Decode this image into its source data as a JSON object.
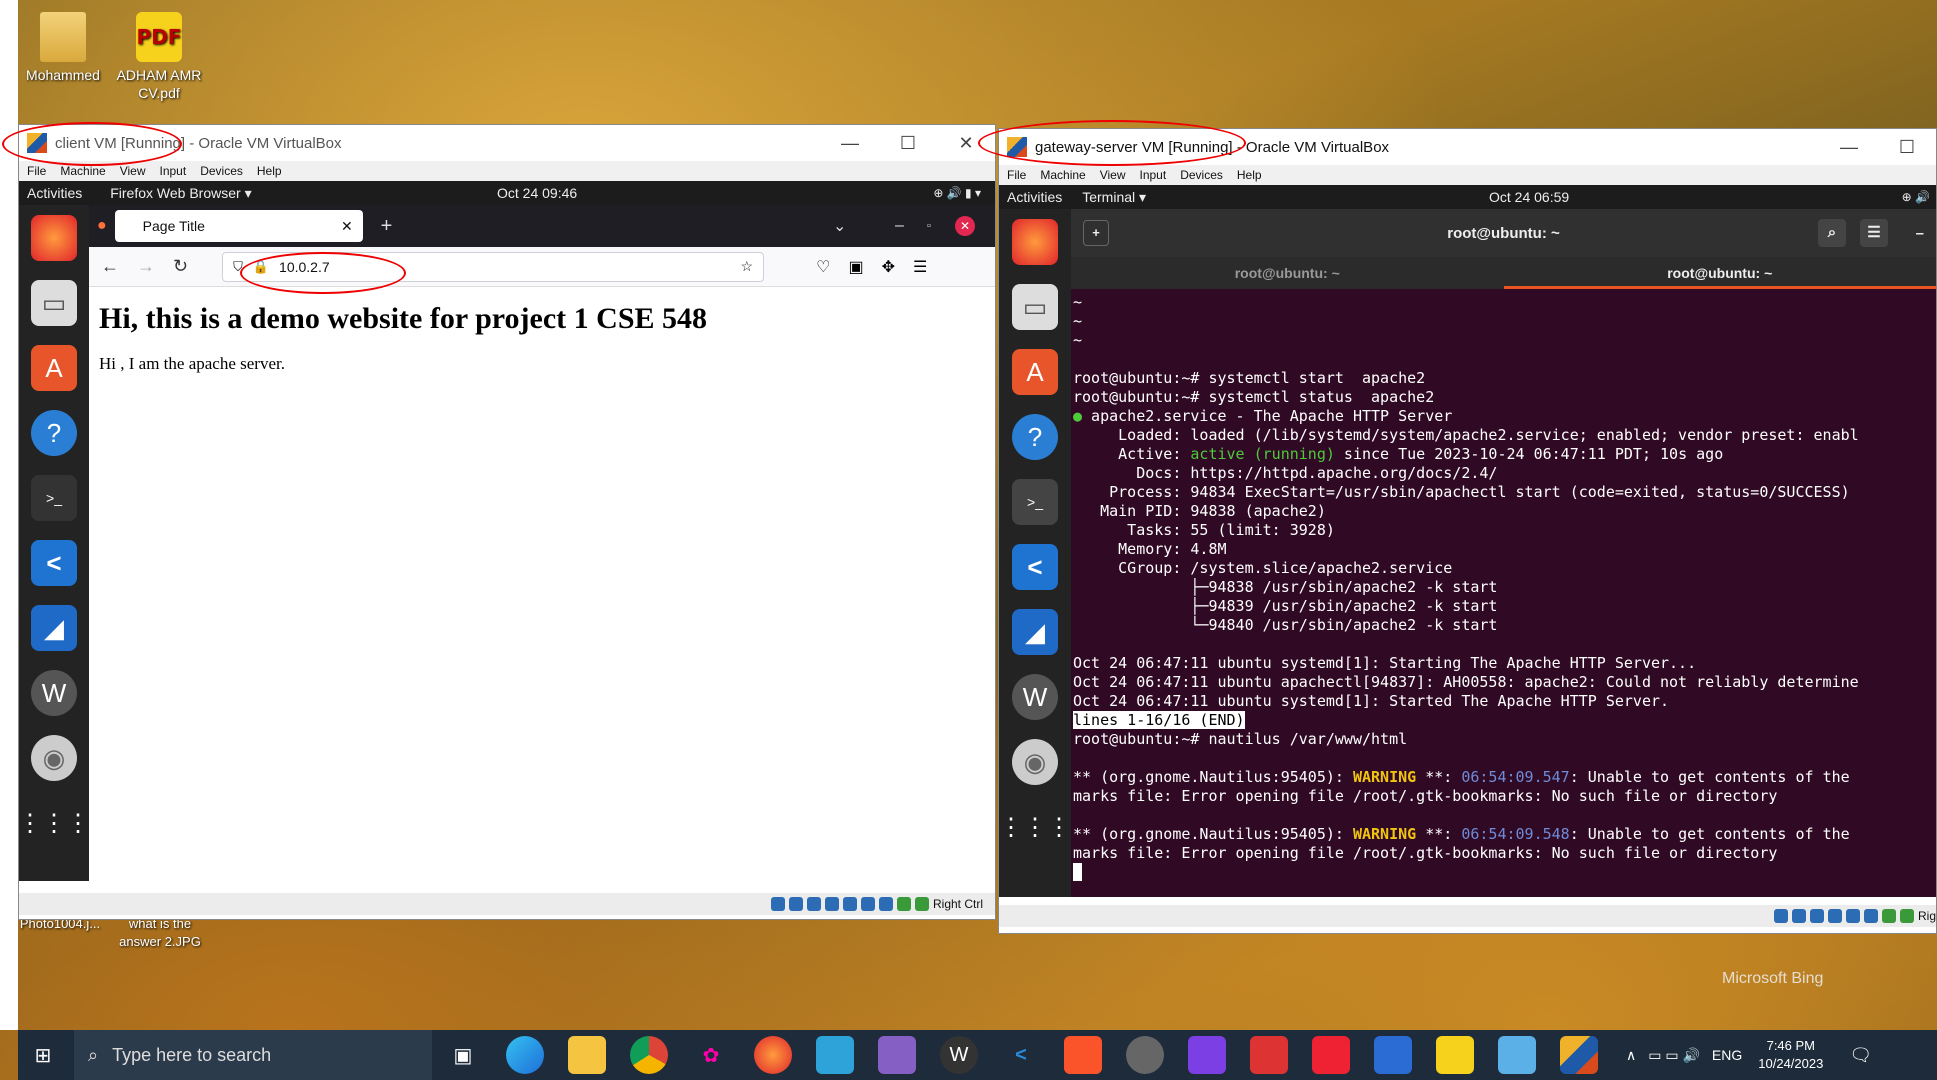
{
  "desktop": {
    "icons": [
      {
        "label": "Mohammed",
        "icon": "folder-icon"
      },
      {
        "label": "ADHAM AMR CV.pdf",
        "icon": "pdf-icon"
      },
      {
        "label": "Photo1004.j...",
        "icon": "image-icon"
      },
      {
        "label": "what is the answer 2.JPG",
        "icon": "image-icon"
      }
    ],
    "watermark": "Microsoft Bing"
  },
  "client_vm": {
    "title_prefix": "client VM [Running]",
    "title_suffix": " - Oracle VM VirtualBox",
    "menu": [
      "File",
      "Machine",
      "View",
      "Input",
      "Devices",
      "Help"
    ],
    "gnome_activities": "Activities",
    "gnome_app": "Firefox Web Browser ▾",
    "gnome_clock": "Oct 24  09:46",
    "browser": {
      "tab_title": "Page Title",
      "url": "10.0.2.7",
      "heading": "Hi, this is a demo website for project 1 CSE 548",
      "paragraph": "Hi , I am the apache server."
    },
    "host_key": "Right Ctrl"
  },
  "gateway_vm": {
    "title_prefix": "gateway-server VM [Running]",
    "title_suffix": " - Oracle VM VirtualBox",
    "menu": [
      "File",
      "Machine",
      "View",
      "Input",
      "Devices",
      "Help"
    ],
    "gnome_activities": "Activities",
    "gnome_app": "Terminal ▾",
    "gnome_clock": "Oct 24  06:59",
    "terminal": {
      "window_title": "root@ubuntu: ~",
      "tabs": [
        "root@ubuntu: ~",
        "root@ubuntu: ~"
      ],
      "lines": [
        "~",
        "~",
        "~",
        "",
        "root@ubuntu:~# systemctl start  apache2",
        "root@ubuntu:~# systemctl status  apache2",
        "● apache2.service - The Apache HTTP Server",
        "     Loaded: loaded (/lib/systemd/system/apache2.service; enabled; vendor preset: enabl",
        "     Active: active (running) since Tue 2023-10-24 06:47:11 PDT; 10s ago",
        "       Docs: https://httpd.apache.org/docs/2.4/",
        "    Process: 94834 ExecStart=/usr/sbin/apachectl start (code=exited, status=0/SUCCESS)",
        "   Main PID: 94838 (apache2)",
        "      Tasks: 55 (limit: 3928)",
        "     Memory: 4.8M",
        "     CGroup: /system.slice/apache2.service",
        "             ├─94838 /usr/sbin/apache2 -k start",
        "             ├─94839 /usr/sbin/apache2 -k start",
        "             └─94840 /usr/sbin/apache2 -k start",
        "",
        "Oct 24 06:47:11 ubuntu systemd[1]: Starting The Apache HTTP Server...",
        "Oct 24 06:47:11 ubuntu apachectl[94837]: AH00558: apache2: Could not reliably determine",
        "Oct 24 06:47:11 ubuntu systemd[1]: Started The Apache HTTP Server.",
        "lines 1-16/16 (END)",
        "root@ubuntu:~# nautilus /var/www/html",
        "",
        "** (org.gnome.Nautilus:95405): WARNING **: 06:54:09.547: Unable to get contents of the",
        "marks file: Error opening file /root/.gtk-bookmarks: No such file or directory",
        "",
        "** (org.gnome.Nautilus:95405): WARNING **: 06:54:09.548: Unable to get contents of the",
        "marks file: Error opening file /root/.gtk-bookmarks: No such file or directory"
      ]
    },
    "host_key": "Rig"
  },
  "taskbar": {
    "search_placeholder": "Type here to search",
    "language": "ENG",
    "time": "7:46 PM",
    "date": "10/24/2023"
  }
}
